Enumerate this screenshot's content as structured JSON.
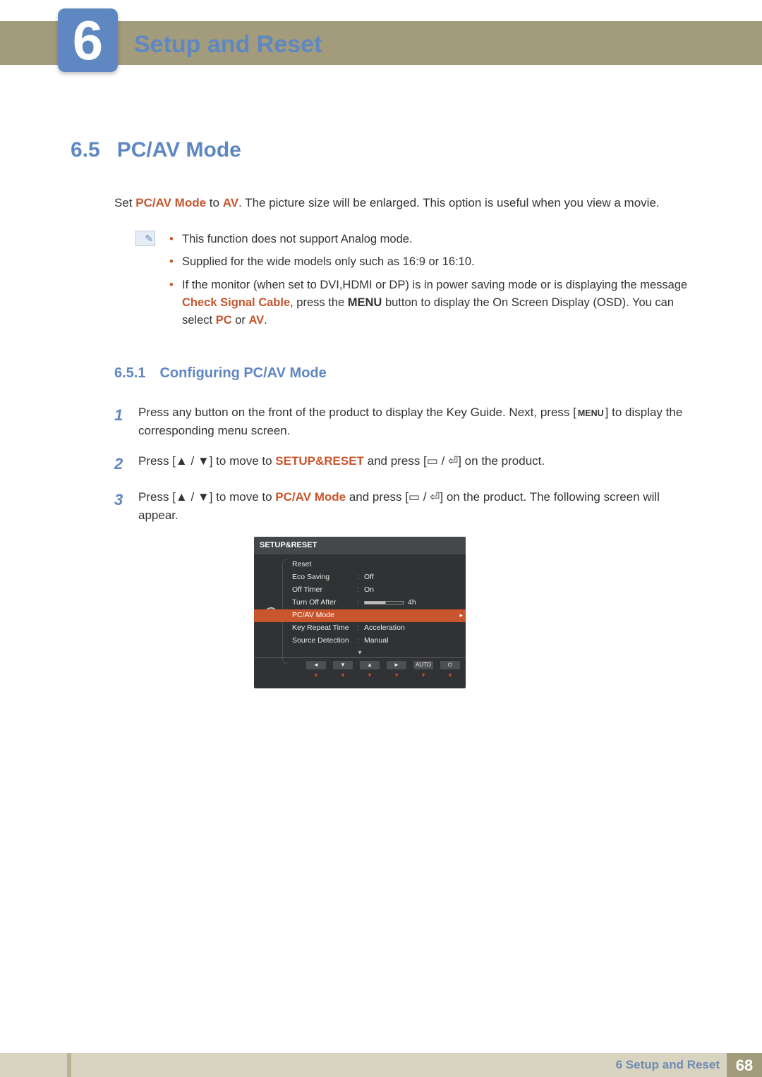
{
  "chapter": {
    "number": "6",
    "title": "Setup and Reset"
  },
  "section": {
    "number": "6.5",
    "title": "PC/AV Mode",
    "intro_parts": {
      "p1": "Set ",
      "b1": "PC/AV Mode",
      "p2": " to ",
      "b2": "AV",
      "p3": ". The picture size will be enlarged. This option is useful when you view a movie."
    }
  },
  "notes": {
    "0": "This function does not support Analog mode.",
    "1": "Supplied for the wide models only such as 16:9 or 16:10.",
    "2": {
      "p1": "If the monitor (when set to DVI,HDMI or DP) is in power saving mode or is displaying the message ",
      "b1": "Check Signal Cable",
      "p2": ", press the ",
      "b2": "MENU",
      "p3": " button to display the On Screen Display (OSD). You can select ",
      "b3": "PC",
      "p4": " or ",
      "b4": "AV",
      "p5": "."
    }
  },
  "subsection": {
    "number": "6.5.1",
    "title": "Configuring PC/AV Mode"
  },
  "steps": {
    "1": {
      "n": "1",
      "p1": "Press any button on the front of the product to display the Key Guide. Next, press [",
      "menu": "MENU",
      "p2": "] to display the corresponding menu screen."
    },
    "2": {
      "n": "2",
      "p1": "Press [",
      "arrows": "▲ / ▼",
      "p2": "] to move to ",
      "b1": "SETUP&RESET",
      "p3": " and press [",
      "enter": "▭ / ⏎",
      "p4": "] on the product."
    },
    "3": {
      "n": "3",
      "p1": "Press [",
      "arrows": "▲ / ▼",
      "p2": "] to move to ",
      "b1": "PC/AV Mode",
      "p3": " and press [",
      "enter": "▭ / ⏎",
      "p4": "] on the product. The following screen will appear."
    }
  },
  "osd": {
    "title": "SETUP&RESET",
    "rows": {
      "0": {
        "label": "Reset",
        "val": ""
      },
      "1": {
        "label": "Eco Saving",
        "val": "Off"
      },
      "2": {
        "label": "Off Timer",
        "val": "On"
      },
      "3": {
        "label": "Turn Off After",
        "val": "4h"
      },
      "4": {
        "label": "PC/AV Mode",
        "val": ""
      },
      "5": {
        "label": "Key Repeat Time",
        "val": "Acceleration"
      },
      "6": {
        "label": "Source Detection",
        "val": "Manual"
      }
    },
    "more": "▾",
    "nav": {
      "0": {
        "top": "◄",
        "bot": "▾"
      },
      "1": {
        "top": "▼",
        "bot": "▾"
      },
      "2": {
        "top": "▲",
        "bot": "▾"
      },
      "3": {
        "top": "►",
        "bot": "▾"
      },
      "4": {
        "top": "AUTO",
        "bot": "▾"
      },
      "5": {
        "top": "⏻",
        "bot": "▾"
      }
    }
  },
  "footer": {
    "label": "6 Setup and Reset",
    "page": "68"
  }
}
